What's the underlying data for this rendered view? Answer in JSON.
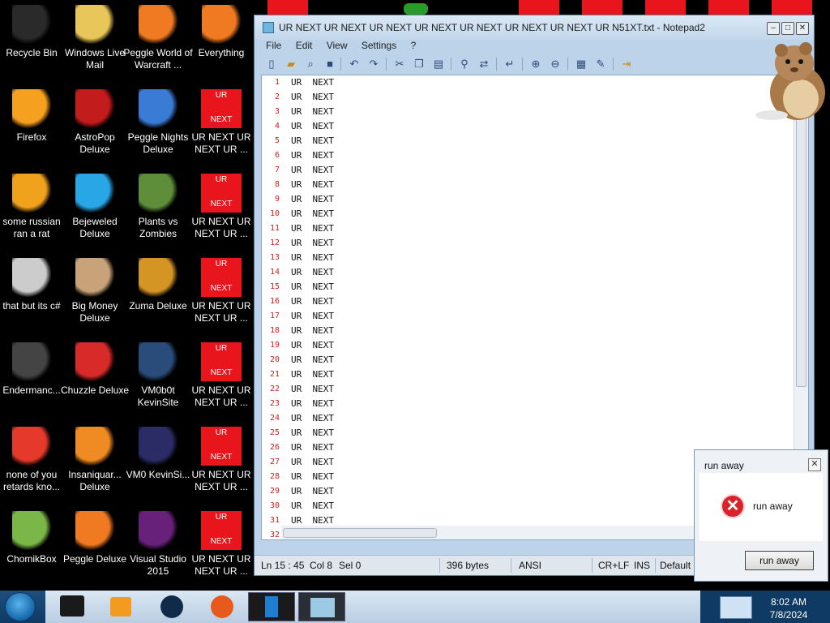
{
  "desktop": {
    "icons": [
      {
        "label": "Recycle Bin",
        "icon": "recycle-bin-icon",
        "color": "#2a2a2a"
      },
      {
        "label": "Windows Live Mail",
        "icon": "mail-icon",
        "color": "#e8c659"
      },
      {
        "label": "Peggle World of Warcraft ...",
        "icon": "peggle-icon",
        "color": "#f07a22"
      },
      {
        "label": "Everything",
        "icon": "everything-icon",
        "color": "#f07a22"
      },
      {
        "label": "Firefox",
        "icon": "firefox-icon",
        "color": "#f5a01e"
      },
      {
        "label": "AstroPop Deluxe",
        "icon": "astropop-icon",
        "color": "#c21c1c"
      },
      {
        "label": "Peggle Nights Deluxe",
        "icon": "peggle-nights-icon",
        "color": "#3a7bd5"
      },
      {
        "label": "UR NEXT UR NEXT UR ...",
        "icon": "ur-next-icon",
        "color": "#e8161c"
      },
      {
        "label": "some russian ran a rat",
        "icon": "rat-icon",
        "color": "#f0a21c"
      },
      {
        "label": "Bejeweled Deluxe",
        "icon": "bejeweled-icon",
        "color": "#29a6e6"
      },
      {
        "label": "Plants vs Zombies",
        "icon": "plants-icon",
        "color": "#5f8e3a"
      },
      {
        "label": "UR NEXT UR NEXT UR ...",
        "icon": "ur-next-icon",
        "color": "#e8161c"
      },
      {
        "label": "that but its c#",
        "icon": "shortcut-icon",
        "color": "#cccccc"
      },
      {
        "label": "Big Money Deluxe",
        "icon": "big-money-icon",
        "color": "#c8a37a"
      },
      {
        "label": "Zuma Deluxe",
        "icon": "zuma-icon",
        "color": "#d59524"
      },
      {
        "label": "UR NEXT UR NEXT UR ...",
        "icon": "ur-next-icon",
        "color": "#e8161c"
      },
      {
        "label": "Endermanc...",
        "icon": "terminal-icon",
        "color": "#444444"
      },
      {
        "label": "Chuzzle Deluxe",
        "icon": "chuzzle-icon",
        "color": "#d92a2a"
      },
      {
        "label": "VM0b0t KevinSite",
        "icon": "vm-icon",
        "color": "#2a4c7a"
      },
      {
        "label": "UR NEXT UR NEXT UR ...",
        "icon": "ur-next-icon",
        "color": "#e8161c"
      },
      {
        "label": "none of you retards kno...",
        "icon": "peggle-icon",
        "color": "#e53a2b"
      },
      {
        "label": "Insaniquar... Deluxe",
        "icon": "fish-icon",
        "color": "#f08a22"
      },
      {
        "label": "VM0 KevinSi...",
        "icon": "vm-icon",
        "color": "#2b2b66"
      },
      {
        "label": "UR NEXT UR NEXT UR ...",
        "icon": "ur-next-icon",
        "color": "#e8161c"
      },
      {
        "label": "ChomikBox",
        "icon": "hamster-icon",
        "color": "#7ab648"
      },
      {
        "label": "Peggle Deluxe",
        "icon": "peggle-icon",
        "color": "#f07a22"
      },
      {
        "label": "Visual Studio 2015",
        "icon": "visual-studio-icon",
        "color": "#68217a"
      },
      {
        "label": "UR NEXT UR NEXT UR ...",
        "icon": "ur-next-icon",
        "color": "#e8161c"
      }
    ],
    "ur_badge_top": "UR",
    "ur_badge_bottom": "NEXT"
  },
  "notepad": {
    "title": "UR NEXT UR NEXT UR NEXT UR NEXT UR NEXT UR NEXT UR NEXT UR N51XT.txt - Notepad2",
    "menu": [
      "File",
      "Edit",
      "View",
      "Settings",
      "?"
    ],
    "line_text": "UR  NEXT",
    "line_numbers": [
      "1",
      "2",
      "3",
      "4",
      "5",
      "6",
      "7",
      "8",
      "9",
      "10",
      "11",
      "12",
      "13",
      "14",
      "15",
      "16",
      "17",
      "18",
      "19",
      "20",
      "21",
      "22",
      "23",
      "24",
      "25",
      "26",
      "27",
      "28",
      "29",
      "30",
      "31",
      "32"
    ],
    "status": {
      "position": "Ln 15 : 45",
      "col": "Col 8",
      "sel": "Sel 0",
      "size": "396 bytes",
      "encoding": "ANSI",
      "eol": "CR+LF",
      "mode": "INS",
      "scheme": "Default"
    }
  },
  "dialog": {
    "title": "run away",
    "message": "run away",
    "button": "run away",
    "close": "✕",
    "error_glyph": "✕"
  },
  "taskbar": {
    "time": "8:02 AM",
    "date": "7/8/2024"
  },
  "colors": {
    "accent_red": "#e8161c",
    "taskbar": "#1d4f7f"
  }
}
